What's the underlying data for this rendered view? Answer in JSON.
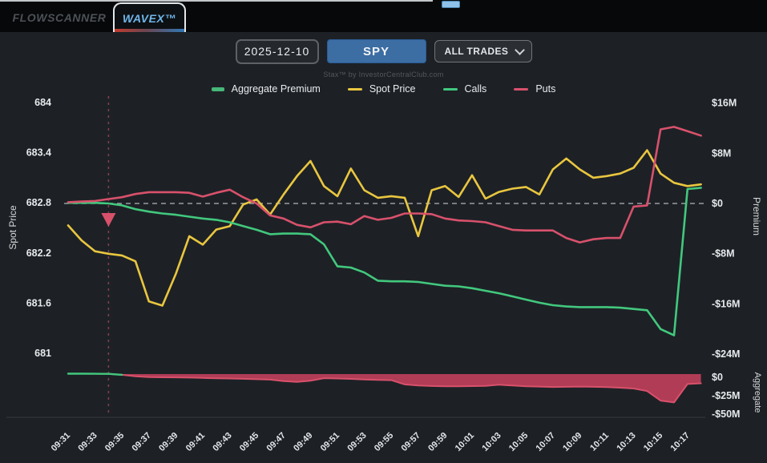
{
  "tabs": [
    {
      "label": "FLOWSCANNER",
      "active": false
    },
    {
      "label": "WAVEX™",
      "active": true
    }
  ],
  "controls": {
    "date_value": "2025-12-10",
    "ticker_label": "SPY",
    "trades_selected": "ALL TRADES"
  },
  "watermark": "Stax™ by InvestorCentralClub.com",
  "legend": {
    "items": [
      {
        "label": "Aggregate Premium",
        "swatch": "bar",
        "color": "#47b879"
      },
      {
        "label": "Spot Price",
        "swatch": "line",
        "color": "#e9c63f"
      },
      {
        "label": "Calls",
        "swatch": "line",
        "color": "#42c87d"
      },
      {
        "label": "Puts",
        "swatch": "line",
        "color": "#d8516b"
      }
    ]
  },
  "chart_data": {
    "type": "line",
    "title": "",
    "x_label": "",
    "times": [
      "09:31",
      "09:32",
      "09:33",
      "09:34",
      "09:35",
      "09:36",
      "09:37",
      "09:38",
      "09:39",
      "09:40",
      "09:41",
      "09:42",
      "09:43",
      "09:44",
      "09:45",
      "09:46",
      "09:47",
      "09:48",
      "09:49",
      "09:50",
      "09:51",
      "09:52",
      "09:53",
      "09:54",
      "09:55",
      "09:56",
      "09:57",
      "09:58",
      "09:59",
      "10:00",
      "10:01",
      "10:02",
      "10:03",
      "10:04",
      "10:05",
      "10:06",
      "10:07",
      "10:08",
      "10:09",
      "10:10",
      "10:11",
      "10:12",
      "10:13",
      "10:14",
      "10:15",
      "10:16",
      "10:17",
      "10:18"
    ],
    "tick_every": 2,
    "axes": {
      "price": {
        "title": "Spot Price",
        "side": "left",
        "ticks": [
          684,
          683.4,
          682.8,
          682.2,
          681.6,
          681
        ],
        "tick_labels": [
          "684",
          "683.4",
          "682.8",
          "682.2",
          "681.6",
          "681"
        ],
        "range": [
          681,
          684
        ]
      },
      "premium": {
        "title": "Premium",
        "side": "right",
        "ticks": [
          16,
          8,
          0,
          -8,
          -16,
          -24
        ],
        "tick_labels": [
          "$16M",
          "$8M",
          "$0",
          "-$8M",
          "-$16M",
          "-$24M"
        ],
        "range": [
          -24,
          16
        ]
      },
      "aggregate": {
        "title": "Aggregate",
        "side": "right",
        "ticks": [
          0,
          -25,
          -50
        ],
        "tick_labels": [
          "$0",
          "-$25M",
          "-$50M"
        ],
        "range": [
          -50,
          5
        ]
      }
    },
    "series": [
      {
        "name": "Spot Price",
        "axis": "price",
        "color": "#e9c63f",
        "style": "line",
        "values": [
          682.53,
          682.35,
          682.22,
          682.19,
          682.17,
          682.1,
          681.62,
          681.57,
          681.95,
          682.4,
          682.3,
          682.48,
          682.52,
          682.78,
          682.84,
          682.66,
          682.9,
          683.12,
          683.3,
          683.0,
          682.88,
          683.21,
          682.95,
          682.86,
          682.88,
          682.86,
          682.4,
          682.95,
          683.0,
          682.87,
          683.13,
          682.85,
          682.93,
          682.97,
          682.99,
          682.9,
          683.2,
          683.33,
          683.2,
          683.1,
          683.12,
          683.15,
          683.22,
          683.43,
          683.15,
          683.04,
          683.0,
          683.02
        ]
      },
      {
        "name": "Calls",
        "axis": "premium",
        "color": "#42c87d",
        "style": "line",
        "values": [
          0.1,
          0.1,
          0.1,
          0.0,
          -0.3,
          -0.9,
          -1.3,
          -1.6,
          -1.8,
          -2.1,
          -2.4,
          -2.6,
          -3.0,
          -3.6,
          -4.2,
          -4.9,
          -4.8,
          -4.8,
          -4.9,
          -6.5,
          -10.0,
          -10.2,
          -11.0,
          -12.3,
          -12.4,
          -12.4,
          -12.5,
          -12.8,
          -13.1,
          -13.2,
          -13.5,
          -13.9,
          -14.3,
          -14.8,
          -15.3,
          -15.8,
          -16.2,
          -16.4,
          -16.5,
          -16.5,
          -16.5,
          -16.6,
          -16.8,
          -17.0,
          -20.0,
          -21.0,
          2.3,
          2.5
        ]
      },
      {
        "name": "Puts",
        "axis": "premium",
        "color": "#d8516b",
        "style": "line",
        "values": [
          0.2,
          0.3,
          0.4,
          0.7,
          1.0,
          1.5,
          1.8,
          1.8,
          1.8,
          1.7,
          1.1,
          1.7,
          2.2,
          1.0,
          0.0,
          -1.9,
          -2.4,
          -3.4,
          -3.8,
          -3.0,
          -2.9,
          -3.3,
          -2.0,
          -2.6,
          -2.3,
          -1.6,
          -1.6,
          -1.7,
          -2.4,
          -2.7,
          -2.8,
          -3.0,
          -3.6,
          -4.2,
          -4.3,
          -4.3,
          -4.3,
          -5.5,
          -6.2,
          -5.7,
          -5.5,
          -5.5,
          -0.5,
          -0.3,
          11.8,
          12.2,
          11.5,
          10.8
        ]
      },
      {
        "name": "Aggregate Premium",
        "axis": "aggregate",
        "color": "#d8516b",
        "fill_color": "#c23f5c",
        "positive_color": "#42c87d",
        "style": "area",
        "values": [
          0.5,
          0.5,
          0.4,
          0.3,
          -1.0,
          -3.0,
          -4.0,
          -4.3,
          -4.5,
          -4.8,
          -5.2,
          -5.6,
          -6.0,
          -6.4,
          -7.0,
          -7.5,
          -9.5,
          -10.5,
          -9.0,
          -5.5,
          -6.0,
          -6.5,
          -7.3,
          -7.8,
          -8.3,
          -14.0,
          -15.5,
          -16.2,
          -16.6,
          -16.6,
          -16.3,
          -16.0,
          -14.5,
          -15.5,
          -16.5,
          -17.0,
          -17.5,
          -17.3,
          -17.0,
          -17.3,
          -17.7,
          -18.5,
          -19.6,
          -23.0,
          -36.0,
          -38.5,
          -13.5,
          -12.5
        ]
      }
    ],
    "annotations": {
      "zero_line": {
        "axis": "premium",
        "value": 0,
        "style": "dashed",
        "color": "#b9bec4"
      },
      "vline": {
        "time": "09:34",
        "style": "dashed",
        "color": "#8f4352"
      },
      "marker": {
        "shape": "triangle-down-icon",
        "time": "09:34",
        "color": "#d8516b"
      }
    },
    "legend_position": "top"
  }
}
